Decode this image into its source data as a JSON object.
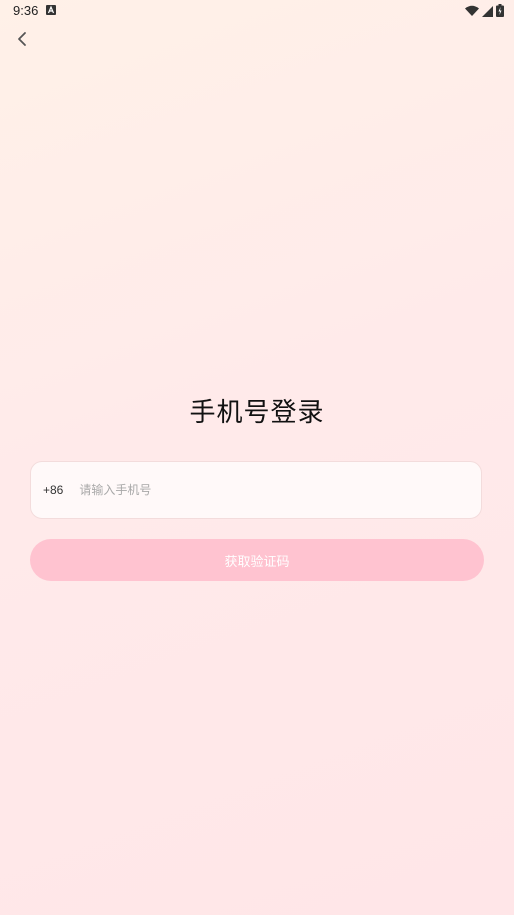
{
  "status_bar": {
    "time": "9:36",
    "notification_icon": "a-badge-icon",
    "wifi_icon": "wifi-icon",
    "signal_icon": "signal-icon",
    "battery_icon": "battery-charging-icon"
  },
  "nav": {
    "back_icon": "chevron-left-icon"
  },
  "login": {
    "title": "手机号登录",
    "country_code": "+86",
    "phone_placeholder": "请输入手机号",
    "phone_value": "",
    "get_code_label": "获取验证码"
  },
  "colors": {
    "button_bg": "#ffc3d0",
    "button_text": "#ffffff",
    "field_border": "#f3dcdc"
  }
}
